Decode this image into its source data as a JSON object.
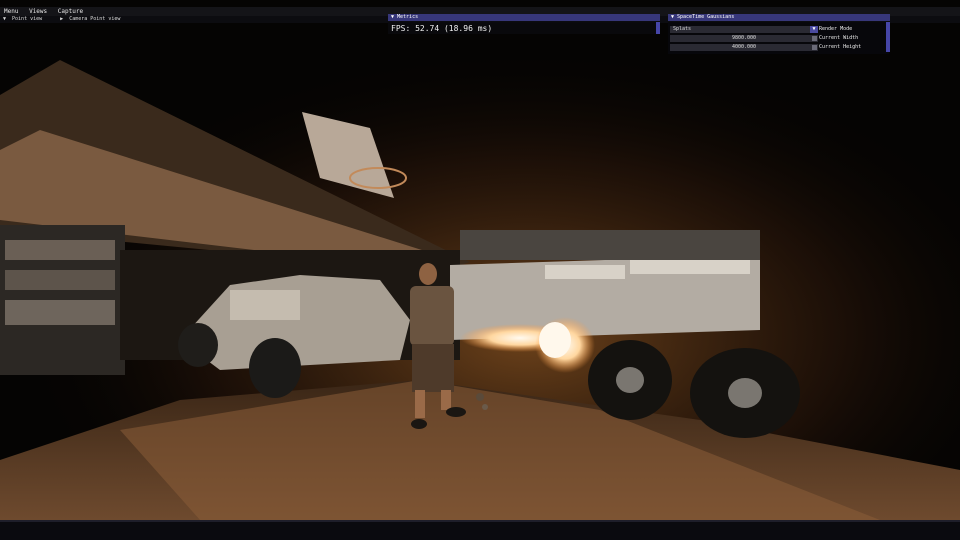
{
  "menubar": {
    "items": [
      "Menu",
      "Views",
      "Capture"
    ]
  },
  "point_view": {
    "tab1": "Point view",
    "tab2": "Camera Point view"
  },
  "metrics": {
    "title": "Metrics",
    "fps_text": "FPS: 52.74 (18.96 ms)"
  },
  "spacetime": {
    "title": "SpaceTime Gaussians",
    "render_mode_value": "Splats",
    "render_mode_label": "Render Mode",
    "width_value": "9800.000",
    "width_label": "Current Width",
    "height_value": "4000.000",
    "height_label": "Current Height"
  },
  "colors": {
    "title_bar": "#37377a",
    "accent": "#4646a8",
    "fire": "#ffd9a0"
  }
}
